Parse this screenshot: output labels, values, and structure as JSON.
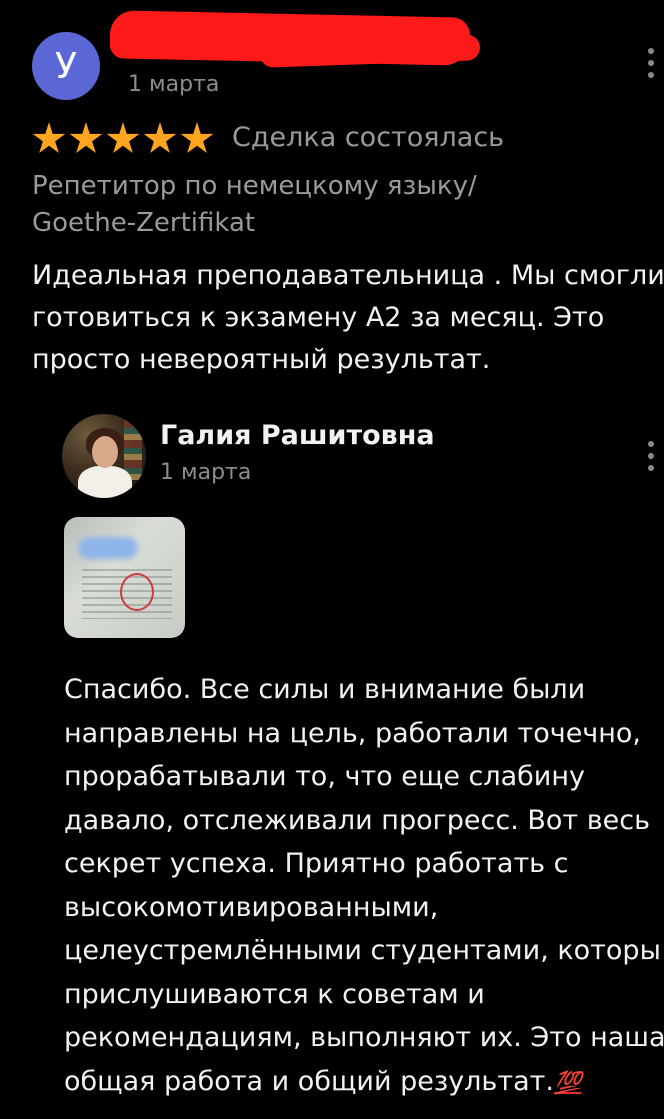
{
  "review": {
    "avatar_letter": "У",
    "date": "1 марта",
    "rating": 5,
    "status": "Сделка состоялась",
    "service_lines": [
      "Репетитор по немецкому языку/",
      "Goethe-Zertifikat"
    ],
    "text_lines": [
      "Идеальная преподавательница . Мы смогли",
      "готовиться к экзамену А2 за месяц. Это",
      "просто невероятный результат."
    ]
  },
  "reply": {
    "author": "Галия Рашитовна",
    "date": "1 марта",
    "text_lines": [
      "Спасибо. Все силы и внимание были",
      "направлены на цель, работали точечно,",
      "прорабатывали то, что еще слабину",
      "давало, отслеживали прогресс. Вот весь",
      "секрет успеха. Приятно работать с",
      "высокомотивированными,",
      "целеустремлёнными студентами, которы",
      "прислушиваются к советам и",
      "рекомендациям, выполняют их. Это наша",
      "общая работа и общий результат."
    ],
    "emoji": "💯"
  },
  "colors": {
    "background": "#000000",
    "avatar": "#5c67d6",
    "star": "#ffa51f",
    "redaction": "#ff1a1a",
    "muted_text": "#8d8d8d"
  },
  "icons": [
    "more-vertical-icon",
    "star-icon"
  ]
}
